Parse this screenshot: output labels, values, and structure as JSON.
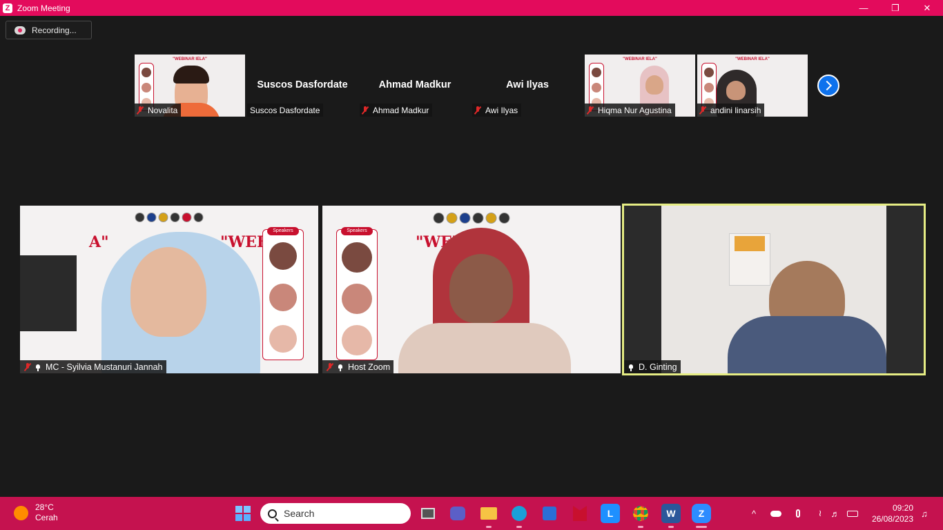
{
  "window": {
    "title": "Zoom Meeting",
    "minimize_icon": "minimize-icon",
    "restore_icon": "restore-icon",
    "close_icon": "close-icon"
  },
  "recording": {
    "label": "Recording..."
  },
  "thumbnails": [
    {
      "name": "Novalita",
      "video": true,
      "muted": true
    },
    {
      "name": "Suscos Dasfordate",
      "display": "Suscos Dasfordate",
      "video": false,
      "muted": false
    },
    {
      "name": "Ahmad Madkur",
      "display": "Ahmad Madkur",
      "video": false,
      "muted": true
    },
    {
      "name": "Awi Ilyas",
      "display": "Awi Ilyas",
      "video": false,
      "muted": true
    },
    {
      "name": "Hiqma Nur Agustina",
      "video": true,
      "muted": true
    },
    {
      "name": "andini linarsih",
      "video": true,
      "muted": true
    }
  ],
  "poster": {
    "heading": "\"WEBINAR IELA\"",
    "speakers_label": "Speakers",
    "big_title": "\"WEBI",
    "big_title_tail": "A\""
  },
  "main_tiles": [
    {
      "name": "MC - Syilvia Mustanuri Jannah",
      "muted": true,
      "raised_hand": true
    },
    {
      "name": "Host Zoom",
      "muted": true,
      "raised_hand": true
    },
    {
      "name": "D. Ginting",
      "muted": false,
      "raised_hand": true,
      "active_speaker": true
    }
  ],
  "colors": {
    "titlebar": "#e30b5c",
    "taskbar": "#c5124f",
    "active_speaker": "#e6ed84",
    "accent_blue": "#0e72ed"
  },
  "taskbar": {
    "weather": {
      "temp": "28°C",
      "condition": "Cerah"
    },
    "search_placeholder": "Search",
    "clock": {
      "time": "09:20",
      "date": "26/08/2023"
    },
    "apps": [
      "start-icon",
      "task-view-icon",
      "teams-icon",
      "file-explorer-icon",
      "edge-icon",
      "store-icon",
      "mcafee-icon",
      "l-app-icon",
      "chrome-icon",
      "word-icon",
      "zoom-icon"
    ]
  }
}
